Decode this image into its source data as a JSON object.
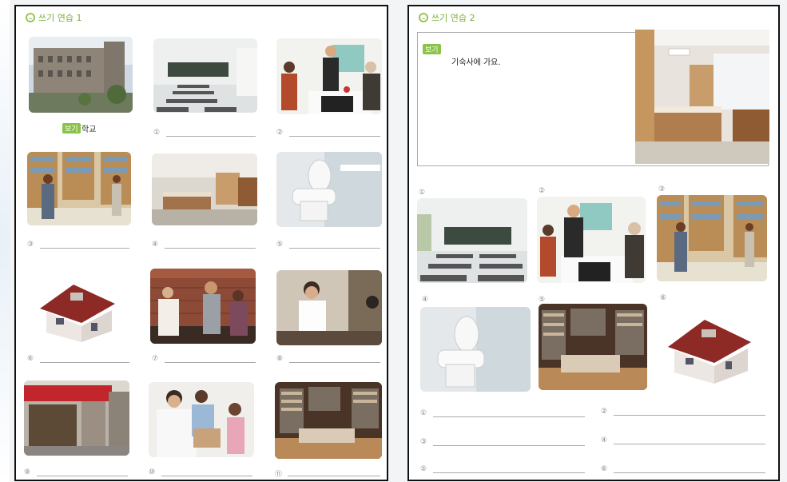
{
  "left": {
    "title": "쓰기 연습 1",
    "example": {
      "tag": "보기",
      "word": "학교"
    },
    "lines": [
      "①",
      "②",
      "③",
      "④",
      "⑤",
      "⑥",
      "⑦",
      "⑧",
      "⑨",
      "⑩",
      "⑪"
    ]
  },
  "right": {
    "title": "쓰기 연습 2",
    "example": {
      "tag": "보기",
      "sentence": "기숙사에 가요."
    },
    "pic_numbers": [
      "①",
      "②",
      "③",
      "④",
      "⑤",
      "⑥"
    ],
    "lines": [
      "①",
      "②",
      "③",
      "④",
      "⑤",
      "⑥"
    ]
  }
}
